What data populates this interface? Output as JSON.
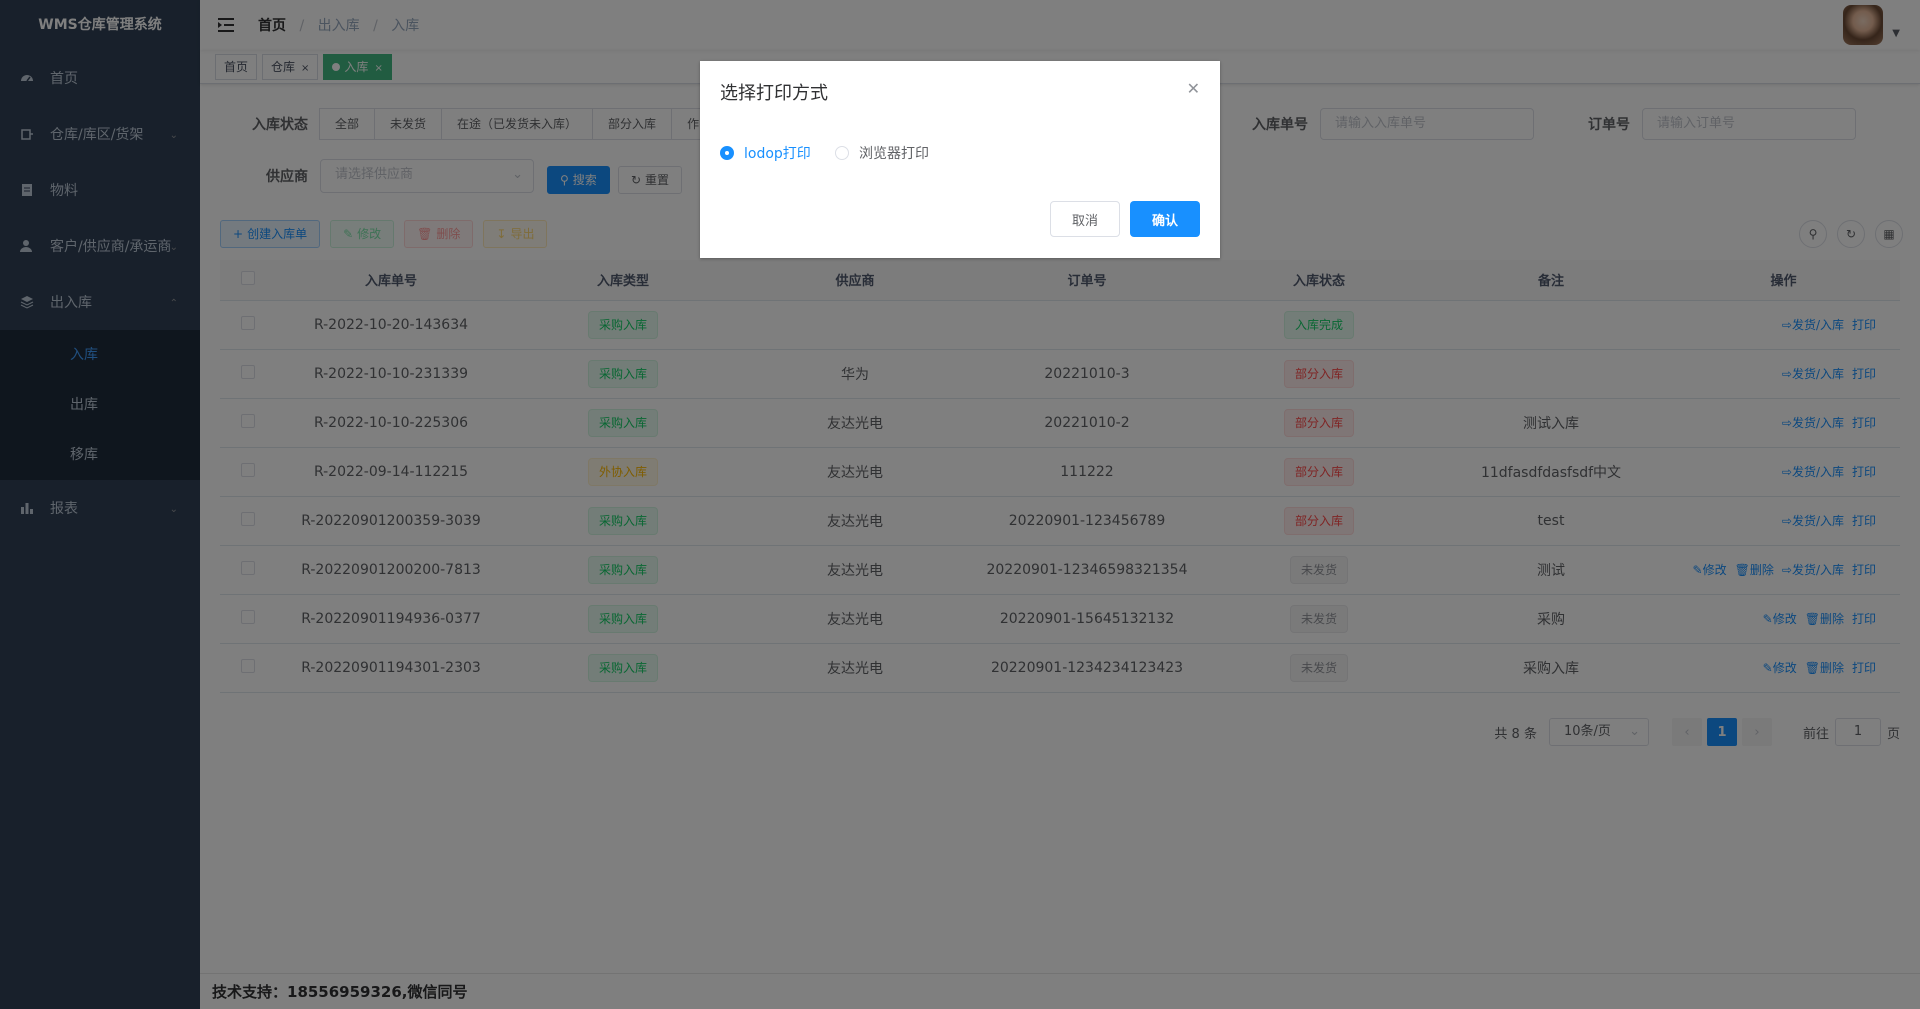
{
  "app": {
    "title": "WMS仓库管理系统"
  },
  "sidebar": {
    "items": [
      {
        "label": "首页"
      },
      {
        "label": "仓库/库区/货架"
      },
      {
        "label": "物料"
      },
      {
        "label": "客户/供应商/承运商"
      },
      {
        "label": "出入库"
      },
      {
        "label": "报表"
      }
    ],
    "sub_items": [
      {
        "label": "入库",
        "active": true
      },
      {
        "label": "出库"
      },
      {
        "label": "移库"
      }
    ]
  },
  "breadcrumb": [
    "首页",
    "出入库",
    "入库"
  ],
  "tags": [
    {
      "label": "首页"
    },
    {
      "label": "仓库"
    },
    {
      "label": "入库",
      "active": true
    }
  ],
  "filters": {
    "status_label": "入库状态",
    "status_options": [
      "全部",
      "未发货",
      "在途（已发货未入库）",
      "部分入库",
      "作"
    ],
    "receipt_no_label": "入库单号",
    "receipt_no_placeholder": "请输入入库单号",
    "order_no_label": "订单号",
    "order_no_placeholder": "请输入订单号",
    "supplier_label": "供应商",
    "supplier_placeholder": "请选择供应商",
    "search_label": "搜索",
    "reset_label": "重置"
  },
  "toolbar": {
    "create_label": "创建入库单",
    "edit_label": "修改",
    "delete_label": "删除",
    "export_label": "导出"
  },
  "table": {
    "columns": [
      "入库单号",
      "入库类型",
      "供应商",
      "订单号",
      "入库状态",
      "备注",
      "操作"
    ],
    "rows": [
      {
        "no": "R-2022-10-20-143634",
        "type": "采购入库",
        "type_style": "success",
        "supplier": "",
        "order": "",
        "status": "入库完成",
        "status_style": "success",
        "remark": "",
        "ops": [
          "发货/入库",
          "打印"
        ]
      },
      {
        "no": "R-2022-10-10-231339",
        "type": "采购入库",
        "type_style": "success",
        "supplier": "华为",
        "order": "20221010-3",
        "status": "部分入库",
        "status_style": "danger",
        "remark": "",
        "ops": [
          "发货/入库",
          "打印"
        ]
      },
      {
        "no": "R-2022-10-10-225306",
        "type": "采购入库",
        "type_style": "success",
        "supplier": "友达光电",
        "order": "20221010-2",
        "status": "部分入库",
        "status_style": "danger",
        "remark": "测试入库",
        "ops": [
          "发货/入库",
          "打印"
        ]
      },
      {
        "no": "R-2022-09-14-112215",
        "type": "外协入库",
        "type_style": "warning",
        "supplier": "友达光电",
        "order": "111222",
        "status": "部分入库",
        "status_style": "danger",
        "remark": "11dfasdfdasfsdf中文",
        "ops": [
          "发货/入库",
          "打印"
        ]
      },
      {
        "no": "R-20220901200359-3039",
        "type": "采购入库",
        "type_style": "success",
        "supplier": "友达光电",
        "order": "20220901-123456789",
        "status": "部分入库",
        "status_style": "danger",
        "remark": "test",
        "ops": [
          "发货/入库",
          "打印"
        ]
      },
      {
        "no": "R-20220901200200-7813",
        "type": "采购入库",
        "type_style": "success",
        "supplier": "友达光电",
        "order": "20220901-12346598321354",
        "status": "未发货",
        "status_style": "info",
        "remark": "测试",
        "ops": [
          "修改",
          "删除",
          "发货/入库",
          "打印"
        ]
      },
      {
        "no": "R-20220901194936-0377",
        "type": "采购入库",
        "type_style": "success",
        "supplier": "友达光电",
        "order": "20220901-15645132132",
        "status": "未发货",
        "status_style": "info",
        "remark": "采购",
        "ops": [
          "修改",
          "删除",
          "打印"
        ]
      },
      {
        "no": "R-20220901194301-2303",
        "type": "采购入库",
        "type_style": "success",
        "supplier": "友达光电",
        "order": "20220901-1234234123423",
        "status": "未发货",
        "status_style": "info",
        "remark": "采购入库",
        "ops": [
          "修改",
          "删除",
          "打印"
        ]
      }
    ]
  },
  "pagination": {
    "total_text": "共 8 条",
    "page_size": "10条/页",
    "current_page": "1",
    "goto_label": "前往",
    "goto_value": "1",
    "page_unit": "页"
  },
  "footer": {
    "text": "技术支持：18556959326,微信同号"
  },
  "dialog": {
    "title": "选择打印方式",
    "options": [
      {
        "label": "lodop打印",
        "checked": true
      },
      {
        "label": "浏览器打印",
        "checked": false
      }
    ],
    "cancel_label": "取消",
    "confirm_label": "确认"
  },
  "colors": {
    "sidebar_bg": "#304156",
    "primary": "#1890ff",
    "active_tag": "#42b983"
  }
}
